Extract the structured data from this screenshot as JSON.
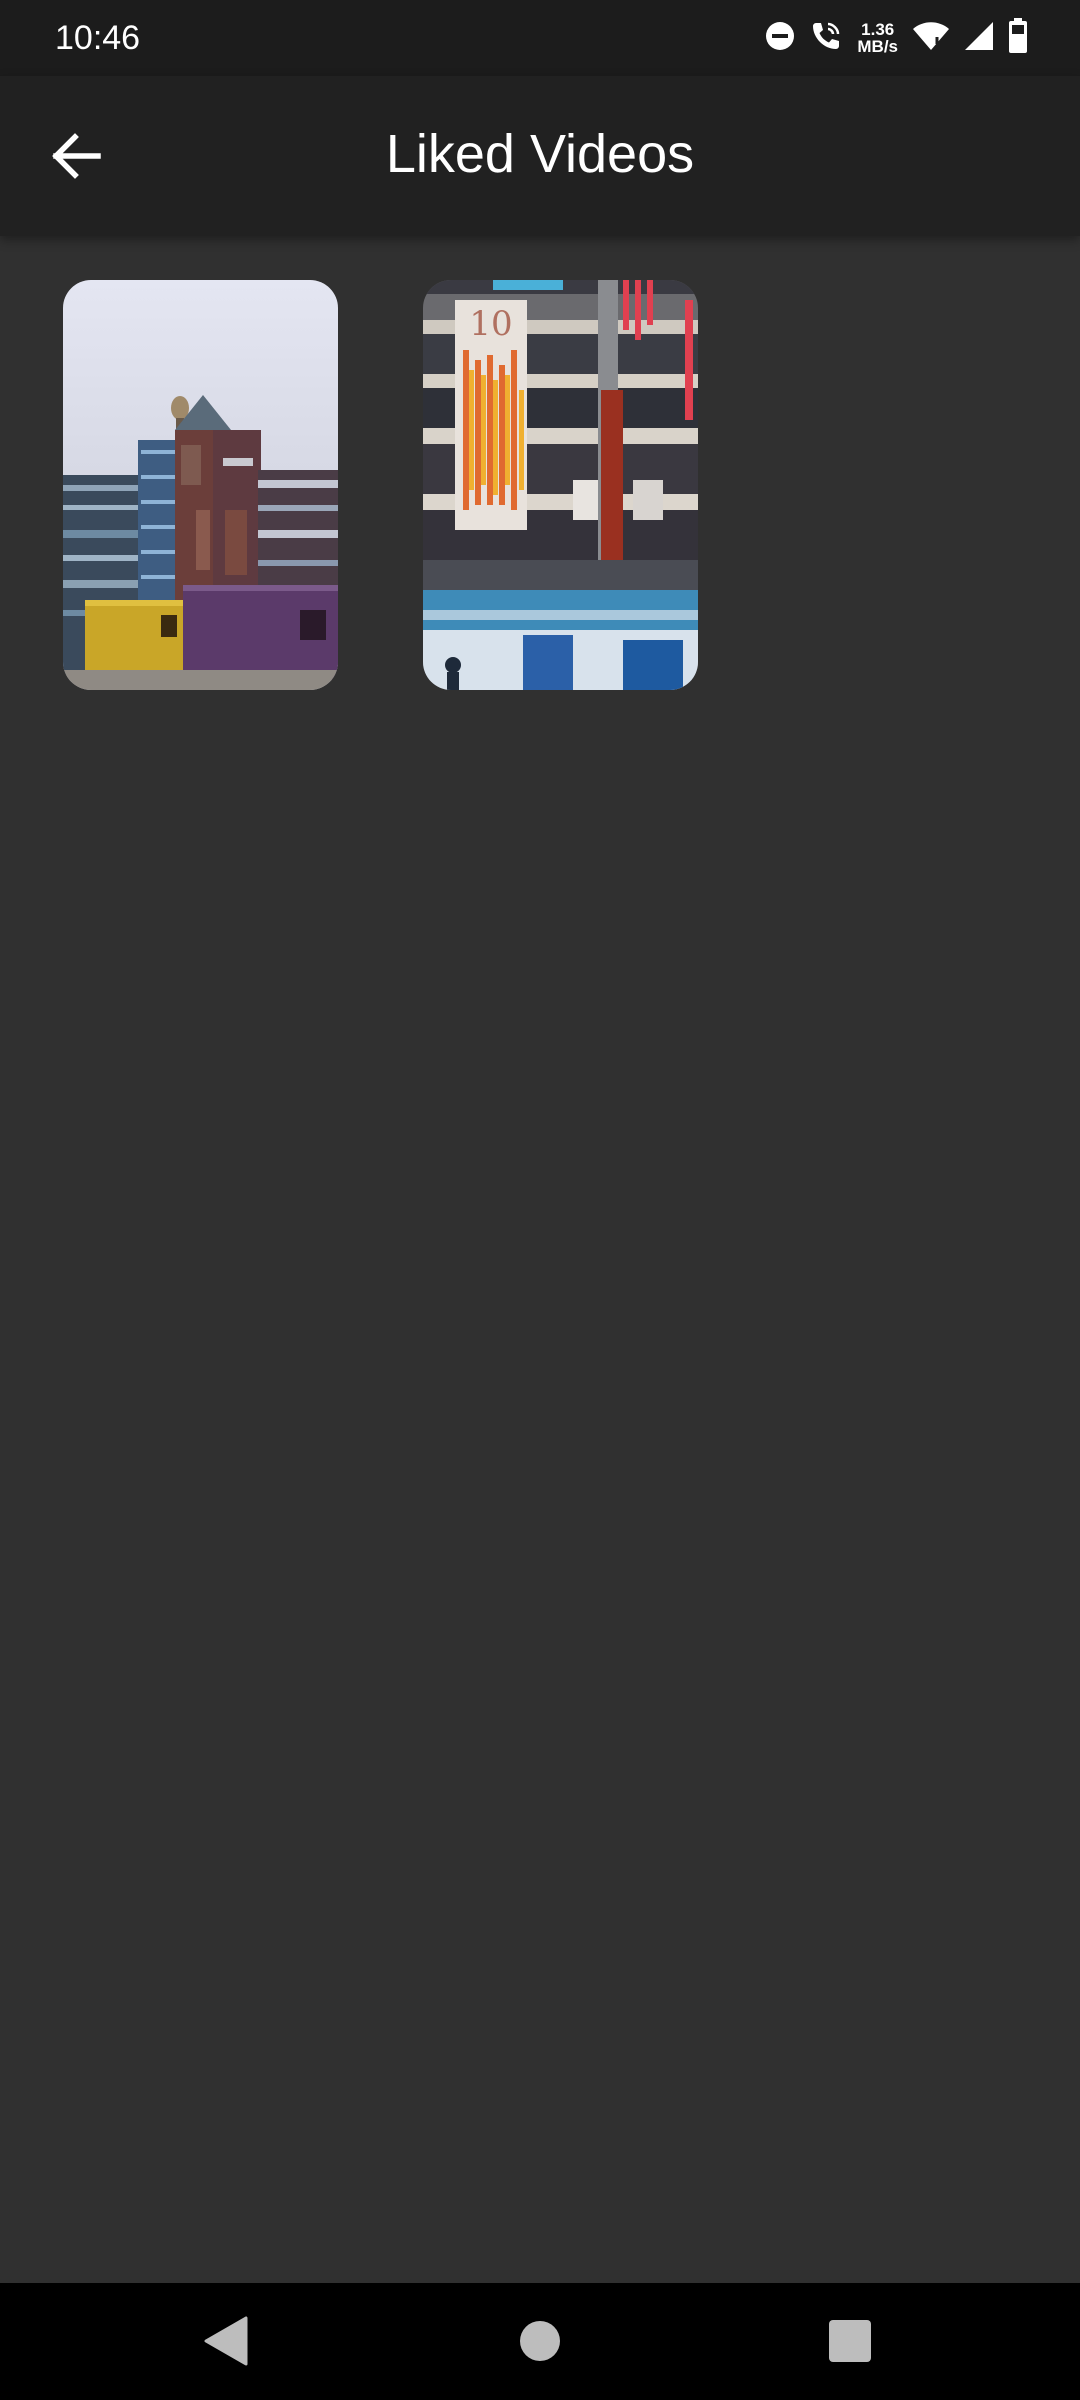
{
  "status_bar": {
    "time": "10:46",
    "net_speed_value": "1.36",
    "net_speed_unit": "MB/s",
    "icons": [
      "do-not-disturb-icon",
      "wifi-call-icon",
      "wifi-icon",
      "cell-signal-icon",
      "battery-icon"
    ]
  },
  "app_bar": {
    "title": "Liked Videos",
    "back_icon": "arrow-back-icon"
  },
  "videos": [
    {
      "thumbnail": "building-with-shipping-containers"
    },
    {
      "thumbnail": "mall-atrium-with-hanging-decorations"
    }
  ],
  "nav_bar": {
    "icons": [
      "back-triangle-icon",
      "home-circle-icon",
      "recents-square-icon"
    ]
  },
  "colors": {
    "background": "#303030",
    "app_bar": "#212121",
    "status_bar": "#1c1c1c",
    "nav_bar": "#000000",
    "text": "#ffffff"
  }
}
